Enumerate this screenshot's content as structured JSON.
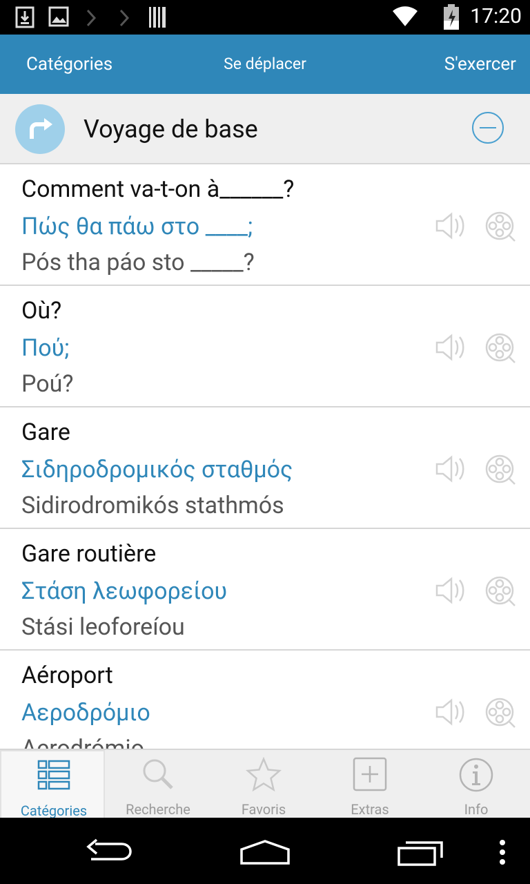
{
  "status_bar": {
    "time": "17:20",
    "icons": [
      "download-icon",
      "image-icon",
      "chevron-right-icon",
      "chevron-right-icon",
      "barcode-icon",
      "wifi-icon",
      "battery-charging-icon"
    ]
  },
  "action_bar": {
    "left": "Catégories",
    "center": "Se déplacer",
    "right": "S'exercer"
  },
  "category": {
    "title": "Voyage de base"
  },
  "phrases": [
    {
      "fr": "Comment va-t-on à______?",
      "gr": "Πώς θα πάω στο ____;",
      "translit": "Pós tha páo sto _____?"
    },
    {
      "fr": "Où?",
      "gr": "Πού;",
      "translit": "Poú?"
    },
    {
      "fr": "Gare",
      "gr": "Σιδηροδρομικός σταθμός",
      "translit": "Sidirodromikós stathmós"
    },
    {
      "fr": "Gare routière",
      "gr": "Στάση λεωφορείου",
      "translit": "Stási leoforeíou"
    },
    {
      "fr": "Aéroport",
      "gr": "Αεροδρόμιο",
      "translit": "Aerodrómio"
    }
  ],
  "tabs": [
    {
      "label": "Catégories",
      "icon": "list-icon",
      "active": true
    },
    {
      "label": "Recherche",
      "icon": "search-icon",
      "active": false
    },
    {
      "label": "Favoris",
      "icon": "star-icon",
      "active": false
    },
    {
      "label": "Extras",
      "icon": "plus-box-icon",
      "active": false
    },
    {
      "label": "Info",
      "icon": "info-icon",
      "active": false
    }
  ],
  "colors": {
    "accent": "#2f87b9",
    "badge": "#9fd0ea",
    "header_bg": "#efefef"
  }
}
